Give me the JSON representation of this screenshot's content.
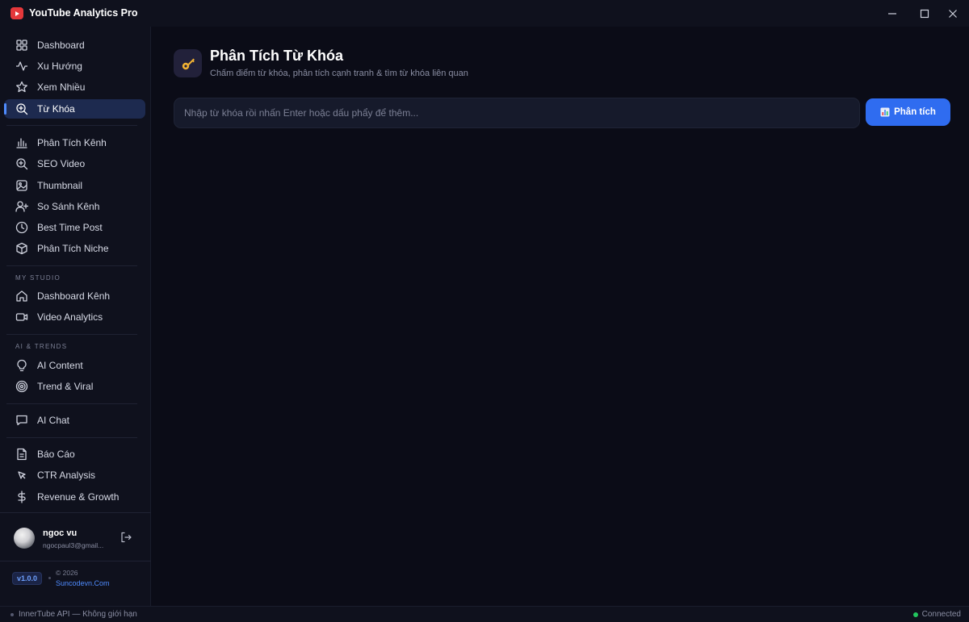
{
  "app": {
    "title": "YouTube Analytics Pro"
  },
  "sidebar": {
    "group1": [
      {
        "label": "Dashboard",
        "icon": "grid-icon"
      },
      {
        "label": "Xu Hướng",
        "icon": "activity-icon"
      },
      {
        "label": "Xem Nhiều",
        "icon": "star-icon"
      },
      {
        "label": "Từ Khóa",
        "icon": "search-plus-icon",
        "active": true
      }
    ],
    "group2": [
      {
        "label": "Phân Tích Kênh",
        "icon": "bar-chart-icon"
      },
      {
        "label": "SEO Video",
        "icon": "zoom-in-icon"
      },
      {
        "label": "Thumbnail",
        "icon": "image-icon"
      },
      {
        "label": "So Sánh Kênh",
        "icon": "user-plus-icon"
      },
      {
        "label": "Best Time Post",
        "icon": "clock-icon"
      },
      {
        "label": "Phân Tích Niche",
        "icon": "box-icon"
      }
    ],
    "studio_title": "MY STUDIO",
    "studio": [
      {
        "label": "Dashboard Kênh",
        "icon": "home-icon"
      },
      {
        "label": "Video Analytics",
        "icon": "video-icon"
      }
    ],
    "ai_title": "AI & TRENDS",
    "ai": [
      {
        "label": "AI Content",
        "icon": "bulb-icon"
      },
      {
        "label": "Trend & Viral",
        "icon": "target-icon"
      }
    ],
    "chat": [
      {
        "label": "AI Chat",
        "icon": "message-icon"
      }
    ],
    "reports": [
      {
        "label": "Báo Cáo",
        "icon": "file-text-icon"
      },
      {
        "label": "CTR Analysis",
        "icon": "cursor-icon"
      },
      {
        "label": "Revenue & Growth",
        "icon": "dollar-icon"
      }
    ]
  },
  "user": {
    "name": "ngoc vu",
    "email": "ngocpaul3@gmail..."
  },
  "footer": {
    "version": "v1.0.0",
    "copyright": "© 2026",
    "site": "Suncodevn.Com"
  },
  "main": {
    "title": "Phân Tích Từ Khóa",
    "subtitle": "Chấm điểm từ khóa, phân tích cạnh tranh & tìm từ khóa liên quan",
    "input_value": "",
    "input_placeholder": "Nhập từ khóa rồi nhấn Enter hoặc dấu phẩy để thêm...",
    "analyze_label": "Phân tích"
  },
  "status": {
    "left": "InnerTube API — Không giới hạn",
    "right": "Connected",
    "connected_color": "#22c55e"
  },
  "colors": {
    "accent": "#2f6cf0",
    "active_bg": "#1d2a4f",
    "logo_red": "#e5383b"
  }
}
